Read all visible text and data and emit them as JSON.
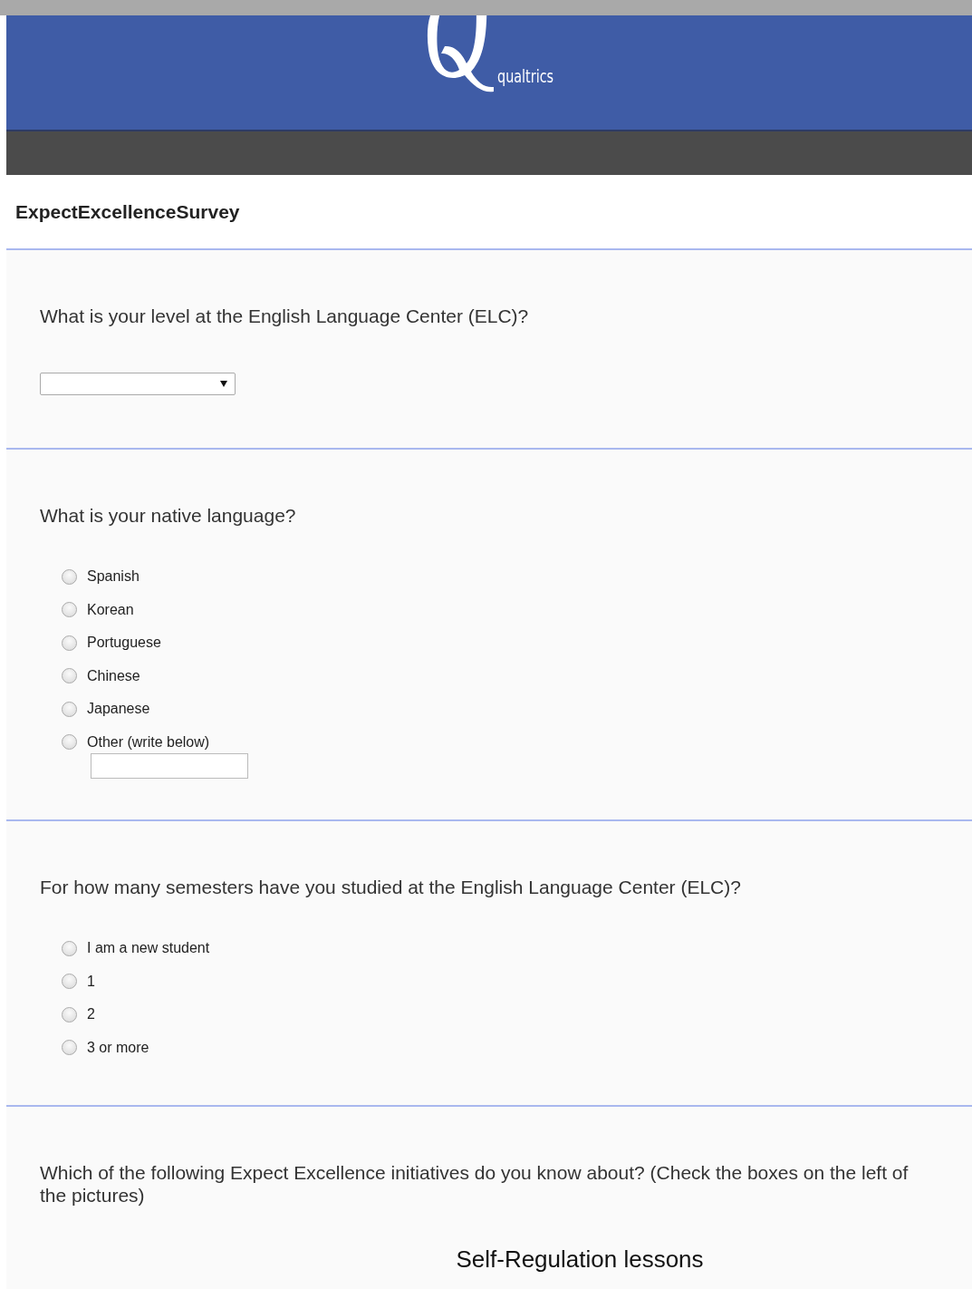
{
  "header": {
    "brand": "qualtrics"
  },
  "survey": {
    "title": "ExpectExcellenceSurvey"
  },
  "questions": [
    {
      "kind": "dropdown",
      "text": "What is your level at the English Language Center (ELC)?"
    },
    {
      "kind": "radio",
      "text": "What is your native language?",
      "options": [
        {
          "label": "Spanish",
          "selected": false,
          "kind": "plain"
        },
        {
          "label": "Korean",
          "selected": false,
          "kind": "plain"
        },
        {
          "label": "Portuguese",
          "selected": false,
          "kind": "plain"
        },
        {
          "label": "Chinese",
          "selected": false,
          "kind": "plain"
        },
        {
          "label": "Japanese",
          "selected": false,
          "kind": "plain"
        },
        {
          "label": "Other (write below)",
          "selected": false,
          "kind": "text_entry"
        }
      ]
    },
    {
      "kind": "radio",
      "text": "For how many semesters have you studied at the English Language Center (ELC)?",
      "options": [
        {
          "label": "I am a new student",
          "selected": false,
          "kind": "plain"
        },
        {
          "label": "1",
          "selected": false,
          "kind": "plain"
        },
        {
          "label": "2",
          "selected": false,
          "kind": "plain"
        },
        {
          "label": "3 or more",
          "selected": false,
          "kind": "plain"
        }
      ]
    },
    {
      "kind": "checkbox_pictures",
      "text": "Which of the following Expect Excellence initiatives do you know about? (Check the boxes on the left of the pictures)",
      "items": [
        {
          "caption": "Self-Regulation lessons"
        }
      ]
    }
  ]
}
